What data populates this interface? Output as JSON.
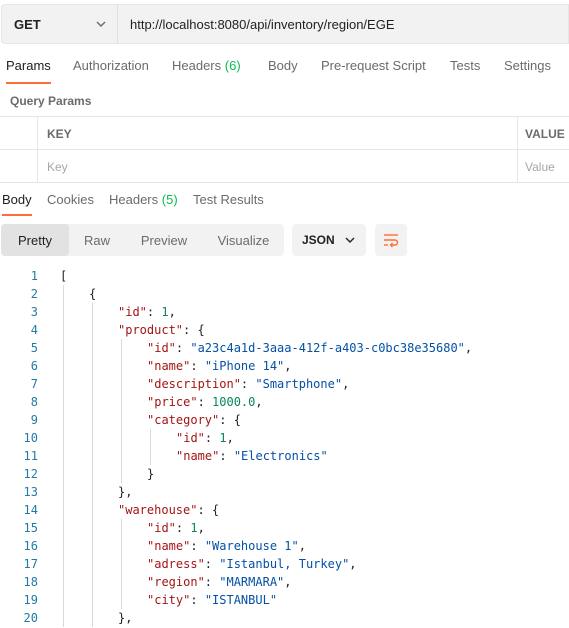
{
  "request": {
    "method": "GET",
    "url": "http://localhost:8080/api/inventory/region/EGE"
  },
  "request_tabs": [
    {
      "label": "Params",
      "count": ""
    },
    {
      "label": "Authorization",
      "count": ""
    },
    {
      "label": "Headers",
      "count": "(6)"
    },
    {
      "label": "Body",
      "count": ""
    },
    {
      "label": "Pre-request Script",
      "count": ""
    },
    {
      "label": "Tests",
      "count": ""
    },
    {
      "label": "Settings",
      "count": ""
    }
  ],
  "query_params": {
    "title": "Query Params",
    "key_header": "KEY",
    "value_header": "VALUE",
    "key_placeholder": "Key",
    "value_placeholder": "Value"
  },
  "response_tabs": [
    {
      "label": "Body",
      "count": ""
    },
    {
      "label": "Cookies",
      "count": ""
    },
    {
      "label": "Headers",
      "count": "(5)"
    },
    {
      "label": "Test Results",
      "count": ""
    }
  ],
  "view_modes": [
    "Pretty",
    "Raw",
    "Preview",
    "Visualize"
  ],
  "format": "JSON",
  "icons": {
    "method_dropdown": "chevron-down-icon",
    "format_dropdown": "chevron-down-icon",
    "wrap": "wrap-lines-icon"
  },
  "colors": {
    "accent": "#ff6c37",
    "count": "#0cbb52",
    "line_number": "#217ca3",
    "json_key": "#a31515",
    "json_string": "#0451a5",
    "json_number": "#098658"
  },
  "code_lines": [
    {
      "n": "1",
      "indent": 0,
      "tokens": [
        [
          "p",
          "["
        ]
      ]
    },
    {
      "n": "2",
      "indent": 1,
      "tokens": [
        [
          "p",
          "{"
        ]
      ]
    },
    {
      "n": "3",
      "indent": 2,
      "tokens": [
        [
          "k",
          "\"id\""
        ],
        [
          "p",
          ": "
        ],
        [
          "n",
          "1"
        ],
        [
          "p",
          ","
        ]
      ]
    },
    {
      "n": "4",
      "indent": 2,
      "tokens": [
        [
          "k",
          "\"product\""
        ],
        [
          "p",
          ": {"
        ]
      ]
    },
    {
      "n": "5",
      "indent": 3,
      "tokens": [
        [
          "k",
          "\"id\""
        ],
        [
          "p",
          ": "
        ],
        [
          "s",
          "\"a23c4a1d-3aaa-412f-a403-c0bc38e35680\""
        ],
        [
          "p",
          ","
        ]
      ]
    },
    {
      "n": "6",
      "indent": 3,
      "tokens": [
        [
          "k",
          "\"name\""
        ],
        [
          "p",
          ": "
        ],
        [
          "s",
          "\"iPhone 14\""
        ],
        [
          "p",
          ","
        ]
      ]
    },
    {
      "n": "7",
      "indent": 3,
      "tokens": [
        [
          "k",
          "\"description\""
        ],
        [
          "p",
          ": "
        ],
        [
          "s",
          "\"Smartphone\""
        ],
        [
          "p",
          ","
        ]
      ]
    },
    {
      "n": "8",
      "indent": 3,
      "tokens": [
        [
          "k",
          "\"price\""
        ],
        [
          "p",
          ": "
        ],
        [
          "n",
          "1000.0"
        ],
        [
          "p",
          ","
        ]
      ]
    },
    {
      "n": "9",
      "indent": 3,
      "tokens": [
        [
          "k",
          "\"category\""
        ],
        [
          "p",
          ": {"
        ]
      ]
    },
    {
      "n": "10",
      "indent": 4,
      "tokens": [
        [
          "k",
          "\"id\""
        ],
        [
          "p",
          ": "
        ],
        [
          "n",
          "1"
        ],
        [
          "p",
          ","
        ]
      ]
    },
    {
      "n": "11",
      "indent": 4,
      "tokens": [
        [
          "k",
          "\"name\""
        ],
        [
          "p",
          ": "
        ],
        [
          "s",
          "\"Electronics\""
        ]
      ]
    },
    {
      "n": "12",
      "indent": 3,
      "tokens": [
        [
          "p",
          "}"
        ]
      ]
    },
    {
      "n": "13",
      "indent": 2,
      "tokens": [
        [
          "p",
          "},"
        ]
      ]
    },
    {
      "n": "14",
      "indent": 2,
      "tokens": [
        [
          "k",
          "\"warehouse\""
        ],
        [
          "p",
          ": {"
        ]
      ]
    },
    {
      "n": "15",
      "indent": 3,
      "tokens": [
        [
          "k",
          "\"id\""
        ],
        [
          "p",
          ": "
        ],
        [
          "n",
          "1"
        ],
        [
          "p",
          ","
        ]
      ]
    },
    {
      "n": "16",
      "indent": 3,
      "tokens": [
        [
          "k",
          "\"name\""
        ],
        [
          "p",
          ": "
        ],
        [
          "s",
          "\"Warehouse 1\""
        ],
        [
          "p",
          ","
        ]
      ]
    },
    {
      "n": "17",
      "indent": 3,
      "tokens": [
        [
          "k",
          "\"adress\""
        ],
        [
          "p",
          ": "
        ],
        [
          "s",
          "\"Istanbul, Turkey\""
        ],
        [
          "p",
          ","
        ]
      ]
    },
    {
      "n": "18",
      "indent": 3,
      "tokens": [
        [
          "k",
          "\"region\""
        ],
        [
          "p",
          ": "
        ],
        [
          "s",
          "\"MARMARA\""
        ],
        [
          "p",
          ","
        ]
      ]
    },
    {
      "n": "19",
      "indent": 3,
      "tokens": [
        [
          "k",
          "\"city\""
        ],
        [
          "p",
          ": "
        ],
        [
          "s",
          "\"ISTANBUL\""
        ]
      ]
    },
    {
      "n": "20",
      "indent": 2,
      "tokens": [
        [
          "p",
          "},"
        ]
      ]
    }
  ]
}
